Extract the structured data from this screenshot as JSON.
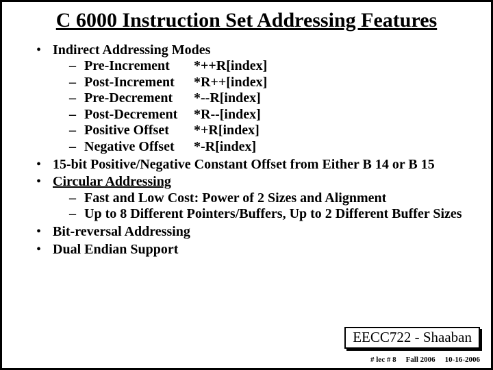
{
  "title": "C 6000 Instruction Set Addressing Features",
  "bullets": {
    "b0": {
      "head": "Indirect Addressing Modes",
      "modes": [
        {
          "name": "Pre-Increment",
          "expr": "*++R[index]"
        },
        {
          "name": "Post-Increment",
          "expr": "*R++[index]"
        },
        {
          "name": "Pre-Decrement",
          "expr": "*--R[index]"
        },
        {
          "name": "Post-Decrement",
          "expr": "*R--[index]"
        },
        {
          "name": "Positive Offset",
          "expr": "*+R[index]"
        },
        {
          "name": "Negative Offset",
          "expr": "*-R[index]"
        }
      ]
    },
    "b1": "15-bit Positive/Negative Constant Offset from Either B 14 or B 15",
    "b2": {
      "head": "Circular Addressing",
      "subs": [
        "Fast and Low Cost: Power of 2 Sizes and Alignment",
        "Up to 8 Different Pointers/Buffers,  Up to 2 Different Buffer Sizes"
      ]
    },
    "b3": "Bit-reversal Addressing",
    "b4": "Dual Endian Support"
  },
  "footer_box": "EECC722 - Shaaban",
  "footer_line": {
    "a": "#  lec # 8",
    "b": "Fall 2006",
    "c": "10-16-2006"
  }
}
